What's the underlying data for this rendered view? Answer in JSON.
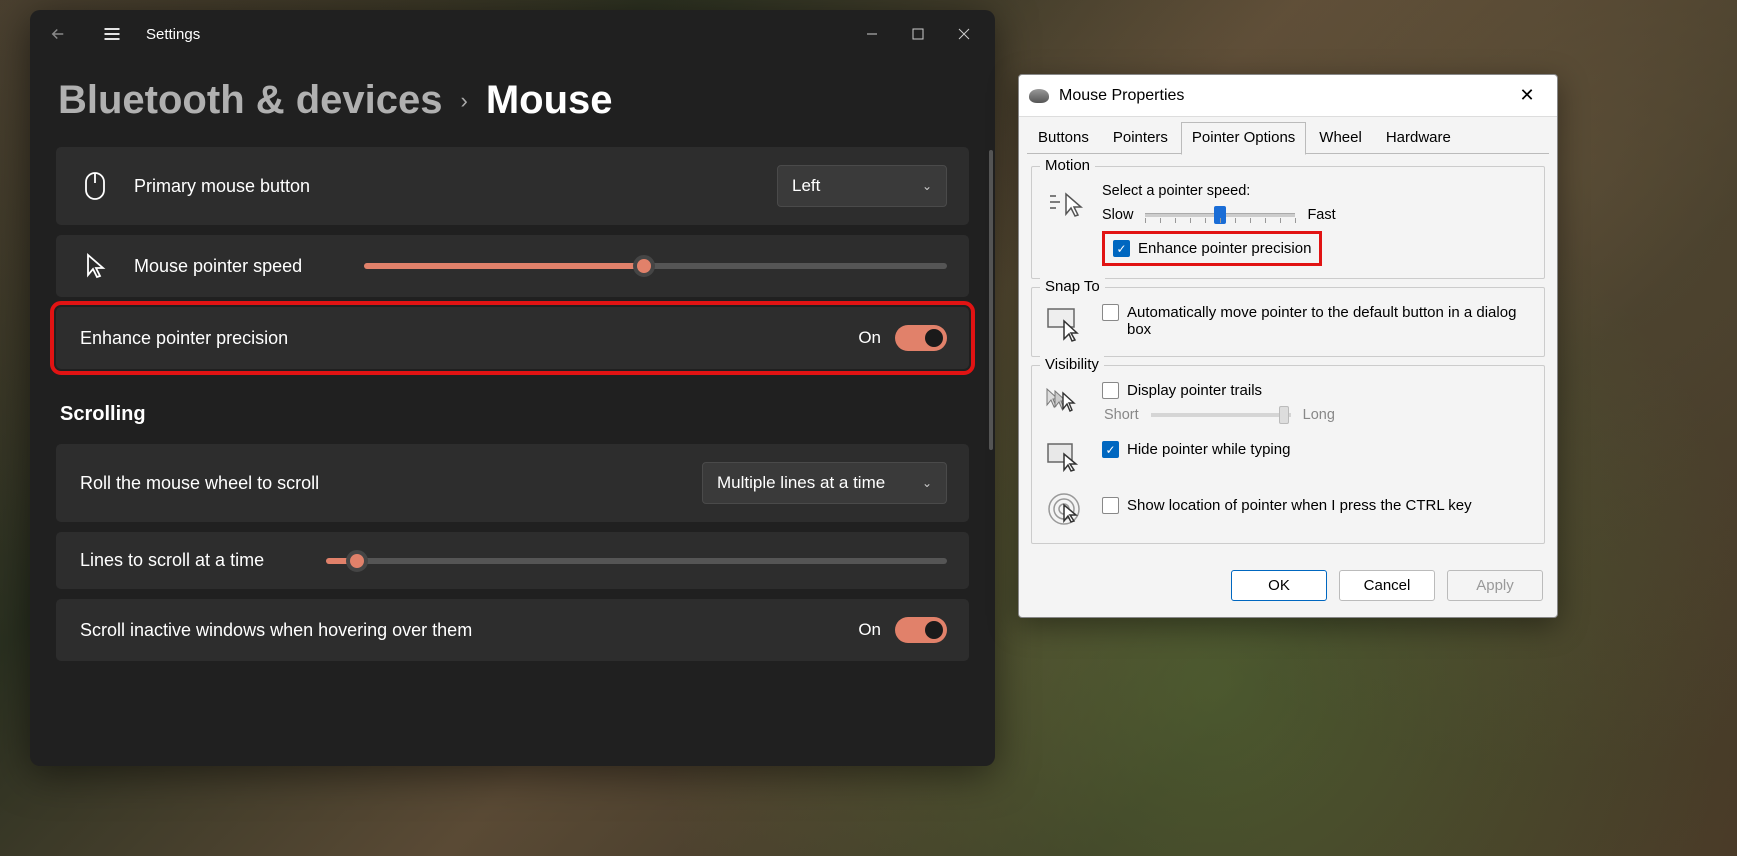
{
  "settings": {
    "app_title": "Settings",
    "breadcrumb_parent": "Bluetooth & devices",
    "breadcrumb_current": "Mouse",
    "primary_button": {
      "label": "Primary mouse button",
      "value": "Left"
    },
    "pointer_speed": {
      "label": "Mouse pointer speed",
      "value_pct": 48
    },
    "enhance_precision": {
      "label": "Enhance pointer precision",
      "state": "On"
    },
    "section_scrolling": "Scrolling",
    "roll_wheel": {
      "label": "Roll the mouse wheel to scroll",
      "value": "Multiple lines at a time"
    },
    "lines_scroll": {
      "label": "Lines to scroll at a time",
      "value_pct": 5
    },
    "inactive_windows": {
      "label": "Scroll inactive windows when hovering over them",
      "state": "On"
    }
  },
  "dialog": {
    "title": "Mouse Properties",
    "tabs": [
      "Buttons",
      "Pointers",
      "Pointer Options",
      "Wheel",
      "Hardware"
    ],
    "active_tab": "Pointer Options",
    "motion": {
      "group": "Motion",
      "label": "Select a pointer speed:",
      "slow": "Slow",
      "fast": "Fast",
      "speed_pct": 50,
      "enhance_label": "Enhance pointer precision",
      "enhance_checked": true
    },
    "snapto": {
      "group": "Snap To",
      "label": "Automatically move pointer to the default button in a dialog box",
      "checked": false
    },
    "visibility": {
      "group": "Visibility",
      "trails": {
        "label": "Display pointer trails",
        "checked": false,
        "short": "Short",
        "long": "Long",
        "pct": 92
      },
      "hide": {
        "label": "Hide pointer while typing",
        "checked": true
      },
      "ctrl": {
        "label": "Show location of pointer when I press the CTRL key",
        "checked": false
      }
    },
    "buttons": {
      "ok": "OK",
      "cancel": "Cancel",
      "apply": "Apply"
    }
  }
}
